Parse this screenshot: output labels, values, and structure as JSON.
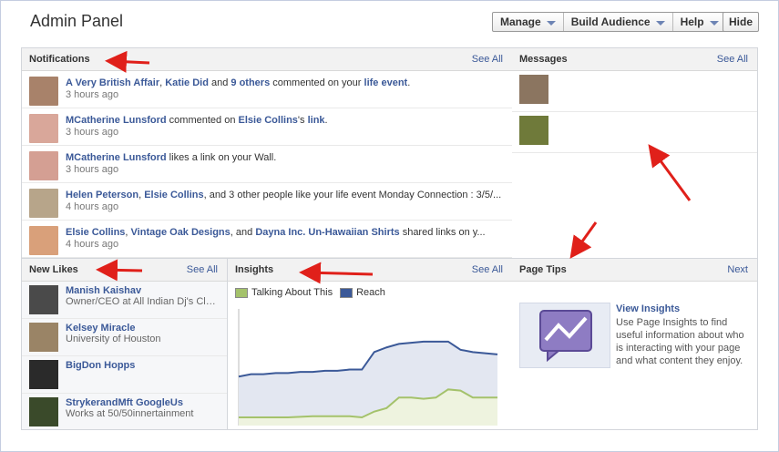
{
  "header": {
    "title": "Admin Panel",
    "menu": [
      "Manage",
      "Build Audience",
      "Help"
    ],
    "hide_label": "Hide"
  },
  "notifications": {
    "title": "Notifications",
    "see_all": "See All",
    "items": [
      {
        "parts": [
          [
            "A Very British Affair",
            1
          ],
          [
            ", ",
            0
          ],
          [
            "Katie Did",
            1
          ],
          [
            " and ",
            0
          ],
          [
            "9 others",
            1
          ],
          [
            " commented on your ",
            0
          ],
          [
            "life event",
            1
          ],
          [
            ".",
            0
          ]
        ],
        "time": "3 hours ago",
        "avatar": "#a8826a"
      },
      {
        "parts": [
          [
            "MCatherine Lunsford",
            1
          ],
          [
            " commented on ",
            0
          ],
          [
            "Elsie Collins",
            1
          ],
          [
            "'s ",
            0
          ],
          [
            "link",
            1
          ],
          [
            ".",
            0
          ]
        ],
        "time": "3 hours ago",
        "avatar": "#d9a79a"
      },
      {
        "parts": [
          [
            "MCatherine Lunsford",
            1
          ],
          [
            " likes a link on your Wall.",
            0
          ]
        ],
        "time": "3 hours ago",
        "avatar": "#d49f93"
      },
      {
        "parts": [
          [
            "Helen Peterson",
            1
          ],
          [
            ", ",
            0
          ],
          [
            "Elsie Collins",
            1
          ],
          [
            ", and 3 other people like your life event Monday Connection : 3/5/...",
            0
          ]
        ],
        "time": "4 hours ago",
        "avatar": "#b7a58a"
      },
      {
        "parts": [
          [
            "Elsie Collins",
            1
          ],
          [
            ", ",
            0
          ],
          [
            "Vintage Oak Designs",
            1
          ],
          [
            ", and ",
            0
          ],
          [
            "Dayna Inc. Un-Hawaiian Shirts",
            1
          ],
          [
            " shared links on y...",
            0
          ]
        ],
        "time": "4 hours ago",
        "avatar": "#d9a07a"
      }
    ]
  },
  "messages": {
    "title": "Messages",
    "see_all": "See All",
    "avatars": [
      "#8b7560",
      "#6f7a3a"
    ]
  },
  "new_likes": {
    "title": "New Likes",
    "see_all": "See All",
    "items": [
      {
        "name": "Manish Kaishav",
        "sub": "Owner/CEO at All Indian Dj's Clu...",
        "avatar": "#4a4a4a"
      },
      {
        "name": "Kelsey Miracle",
        "sub": "University of Houston",
        "avatar": "#9a8466"
      },
      {
        "name": "BigDon Hopps",
        "sub": "",
        "avatar": "#2a2a2a"
      },
      {
        "name": "StrykerandMft GoogleUs",
        "sub": "Works at 50/50innertainment",
        "avatar": "#3a4a2a"
      }
    ]
  },
  "insights": {
    "title": "Insights",
    "see_all": "See All",
    "legend": [
      {
        "label": "Talking About This",
        "color": "#a4c26b"
      },
      {
        "label": "Reach",
        "color": "#3b5998"
      }
    ]
  },
  "chart_data": {
    "type": "area",
    "series": [
      {
        "name": "Reach",
        "color": "#3b5998",
        "values": [
          0.42,
          0.44,
          0.44,
          0.45,
          0.45,
          0.46,
          0.46,
          0.47,
          0.47,
          0.48,
          0.48,
          0.63,
          0.67,
          0.7,
          0.71,
          0.72,
          0.72,
          0.72,
          0.65,
          0.63,
          0.62,
          0.61
        ]
      },
      {
        "name": "Talking About This",
        "color": "#a4c26b",
        "values": [
          0.07,
          0.07,
          0.07,
          0.07,
          0.07,
          0.075,
          0.08,
          0.08,
          0.08,
          0.08,
          0.07,
          0.12,
          0.15,
          0.24,
          0.24,
          0.23,
          0.24,
          0.31,
          0.3,
          0.24,
          0.24,
          0.24
        ]
      }
    ]
  },
  "page_tips": {
    "title": "Page Tips",
    "next": "Next",
    "tip_title": "View Insights",
    "tip_body": "Use Page Insights to find useful information about who is interacting with your page and what content they enjoy."
  },
  "colors": {
    "link": "#3b5998",
    "arrow": "#e0201a"
  }
}
